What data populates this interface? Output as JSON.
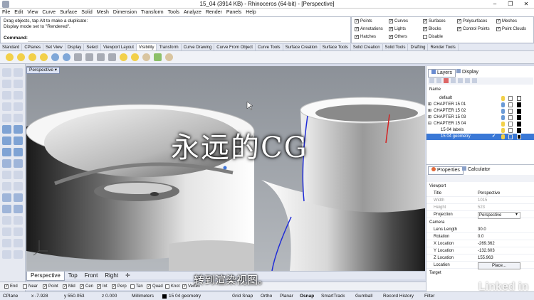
{
  "window": {
    "title": "15_04 (3914 KB) - Rhinoceros (64-bit) - [Perspective]",
    "minimize": "–",
    "maximize": "❐",
    "close": "✕"
  },
  "menu": [
    "File",
    "Edit",
    "View",
    "Curve",
    "Surface",
    "Solid",
    "Mesh",
    "Dimension",
    "Transform",
    "Tools",
    "Analyze",
    "Render",
    "Panels",
    "Help"
  ],
  "command_history": {
    "line1": "Drag objects, tap Alt to make a duplicate:",
    "line2": "Display mode set to \"Rendered\".",
    "prompt": "Command:"
  },
  "selection_filters": [
    {
      "label": "Points",
      "checked": true
    },
    {
      "label": "Curves",
      "checked": true
    },
    {
      "label": "Surfaces",
      "checked": true
    },
    {
      "label": "Polysurfaces",
      "checked": true
    },
    {
      "label": "Meshes",
      "checked": true
    },
    {
      "label": "Annotations",
      "checked": true
    },
    {
      "label": "Lights",
      "checked": true
    },
    {
      "label": "Blocks",
      "checked": true
    },
    {
      "label": "Control Points",
      "checked": true
    },
    {
      "label": "Point Clouds",
      "checked": true
    },
    {
      "label": "Hatches",
      "checked": true
    },
    {
      "label": "Others",
      "checked": true
    },
    {
      "label": "Disable",
      "checked": false
    }
  ],
  "toolbar_tabs": [
    "Standard",
    "CPlanes",
    "Set View",
    "Display",
    "Select",
    "Viewport Layout",
    "Visibility",
    "Transform",
    "Curve Drawing",
    "Curve From Object",
    "Curve Tools",
    "Surface Creation",
    "Surface Tools",
    "Solid Creation",
    "Solid Tools",
    "Drafting",
    "Render Tools"
  ],
  "active_toolbar_tab": "Visibility",
  "viewport": {
    "label": "Perspective",
    "menu_arrow": "▾"
  },
  "view_tabs": [
    "Perspective",
    "Top",
    "Front",
    "Right"
  ],
  "view_tab_add": "✛",
  "osnap": [
    {
      "label": "End",
      "checked": true
    },
    {
      "label": "Near",
      "checked": false
    },
    {
      "label": "Point",
      "checked": true
    },
    {
      "label": "Mid",
      "checked": true
    },
    {
      "label": "Cen",
      "checked": true
    },
    {
      "label": "Int",
      "checked": true
    },
    {
      "label": "Perp",
      "checked": true
    },
    {
      "label": "Tan",
      "checked": false
    },
    {
      "label": "Quad",
      "checked": true
    },
    {
      "label": "Knot",
      "checked": false
    },
    {
      "label": "Vertex",
      "checked": true
    }
  ],
  "status": {
    "cplane": "CPlane",
    "x": "x -7.928",
    "y": "y 550.053",
    "z": "z 0.000",
    "units": "Millimeters",
    "layer": "15 04 geometry",
    "grid_snap": "Grid Snap",
    "ortho": "Ortho",
    "planar": "Planar",
    "osnap": "Osnap",
    "smarttrack": "SmartTrack",
    "gumball": "Gumball",
    "record_history": "Record History",
    "filter": "Filter"
  },
  "layers_panel": {
    "tabs": [
      "Layers",
      "Display"
    ],
    "header": "Name",
    "rows": [
      {
        "name": "default",
        "expander": "",
        "selected": false
      },
      {
        "name": "CHAPTER 15 01",
        "expander": "⊞",
        "selected": false
      },
      {
        "name": "CHAPTER 15 02",
        "expander": "⊞",
        "selected": false
      },
      {
        "name": "CHAPTER 15 03",
        "expander": "⊞",
        "selected": false
      },
      {
        "name": "CHAPTER 15 04",
        "expander": "⊟",
        "selected": false
      },
      {
        "name": "15 04 labels",
        "expander": "",
        "selected": false
      },
      {
        "name": "15 04 geometry",
        "expander": "",
        "selected": true,
        "current_mark": "✔"
      }
    ]
  },
  "properties_panel": {
    "tabs": [
      "Properties",
      "Calculator"
    ],
    "viewport_section": "Viewport",
    "rows": [
      {
        "label": "Title",
        "value": "Perspective",
        "dim": false
      },
      {
        "label": "Width",
        "value": "1015",
        "dim": true
      },
      {
        "label": "Height",
        "value": "523",
        "dim": true
      },
      {
        "label": "Projection",
        "value": "Perspective",
        "dim": false
      }
    ],
    "camera_section": "Camera",
    "camera_rows": [
      {
        "label": "Lens Length",
        "value": "30.0"
      },
      {
        "label": "Rotation",
        "value": "0.0"
      },
      {
        "label": "X Location",
        "value": "-269.362"
      },
      {
        "label": "Y Location",
        "value": "-132.603"
      },
      {
        "label": "Z Location",
        "value": "155.963"
      },
      {
        "label": "Location",
        "value": "Place..."
      }
    ],
    "target_section": "Target"
  },
  "overlays": {
    "watermark": "永远的CG",
    "subtitle": "转到渲染视图。",
    "brand": "Linked in"
  }
}
